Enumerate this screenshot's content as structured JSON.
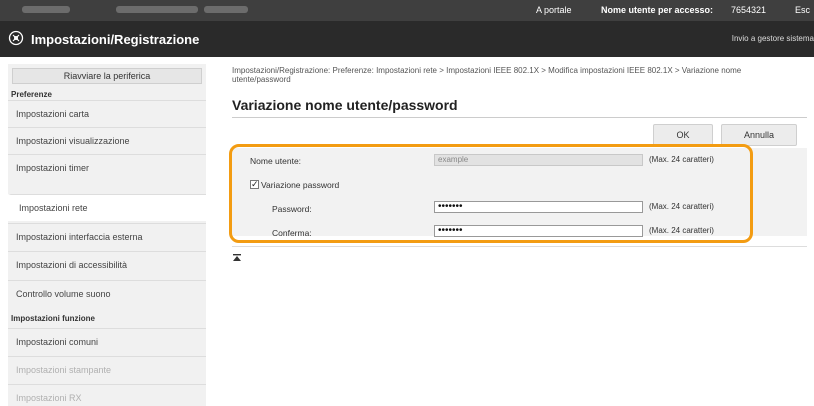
{
  "topbar": {
    "portal_link": "A portale",
    "user_label": "Nome utente per accesso:",
    "user_id": "7654321",
    "logout_label": "Esc"
  },
  "header": {
    "title": "Impostazioni/Registrazione",
    "mail_link": "Invio a gestore sistema"
  },
  "sidebar": {
    "restart_button": "Riavviare la periferica",
    "section_preferences": "Preferenze",
    "section_functions": "Impostazioni funzione",
    "items": [
      {
        "label": "Impostazioni carta"
      },
      {
        "label": "Impostazioni visualizzazione"
      },
      {
        "label": "Impostazioni timer"
      },
      {
        "label": "Impostazioni rete"
      },
      {
        "label": "Impostazioni interfaccia esterna"
      },
      {
        "label": "Impostazioni di accessibilità"
      },
      {
        "label": "Controllo volume suono"
      },
      {
        "label": "Impostazioni comuni"
      },
      {
        "label": "Impostazioni stampante"
      },
      {
        "label": "Impostazioni RX"
      }
    ]
  },
  "main": {
    "breadcrumb": "Impostazioni/Registrazione: Preferenze: Impostazioni rete > Impostazioni IEEE 802.1X > Modifica impostazioni IEEE 802.1X > Variazione nome utente/password",
    "title": "Variazione nome utente/password",
    "ok_button": "OK",
    "cancel_button": "Annulla",
    "form": {
      "username_label": "Nome utente:",
      "username_value": "example",
      "username_note": "(Max. 24 caratteri)",
      "change_password_label": "Variazione password",
      "change_password_checked": "✓",
      "password_label": "Password:",
      "password_value": "•••••••",
      "password_note": "(Max. 24 caratteri)",
      "confirm_label": "Conferma:",
      "confirm_value": "•••••••",
      "confirm_note": "(Max. 24 caratteri)"
    }
  },
  "colors": {
    "highlight": "#f39c12",
    "topbar": "#3f3f3f",
    "header": "#2a2a2a"
  }
}
